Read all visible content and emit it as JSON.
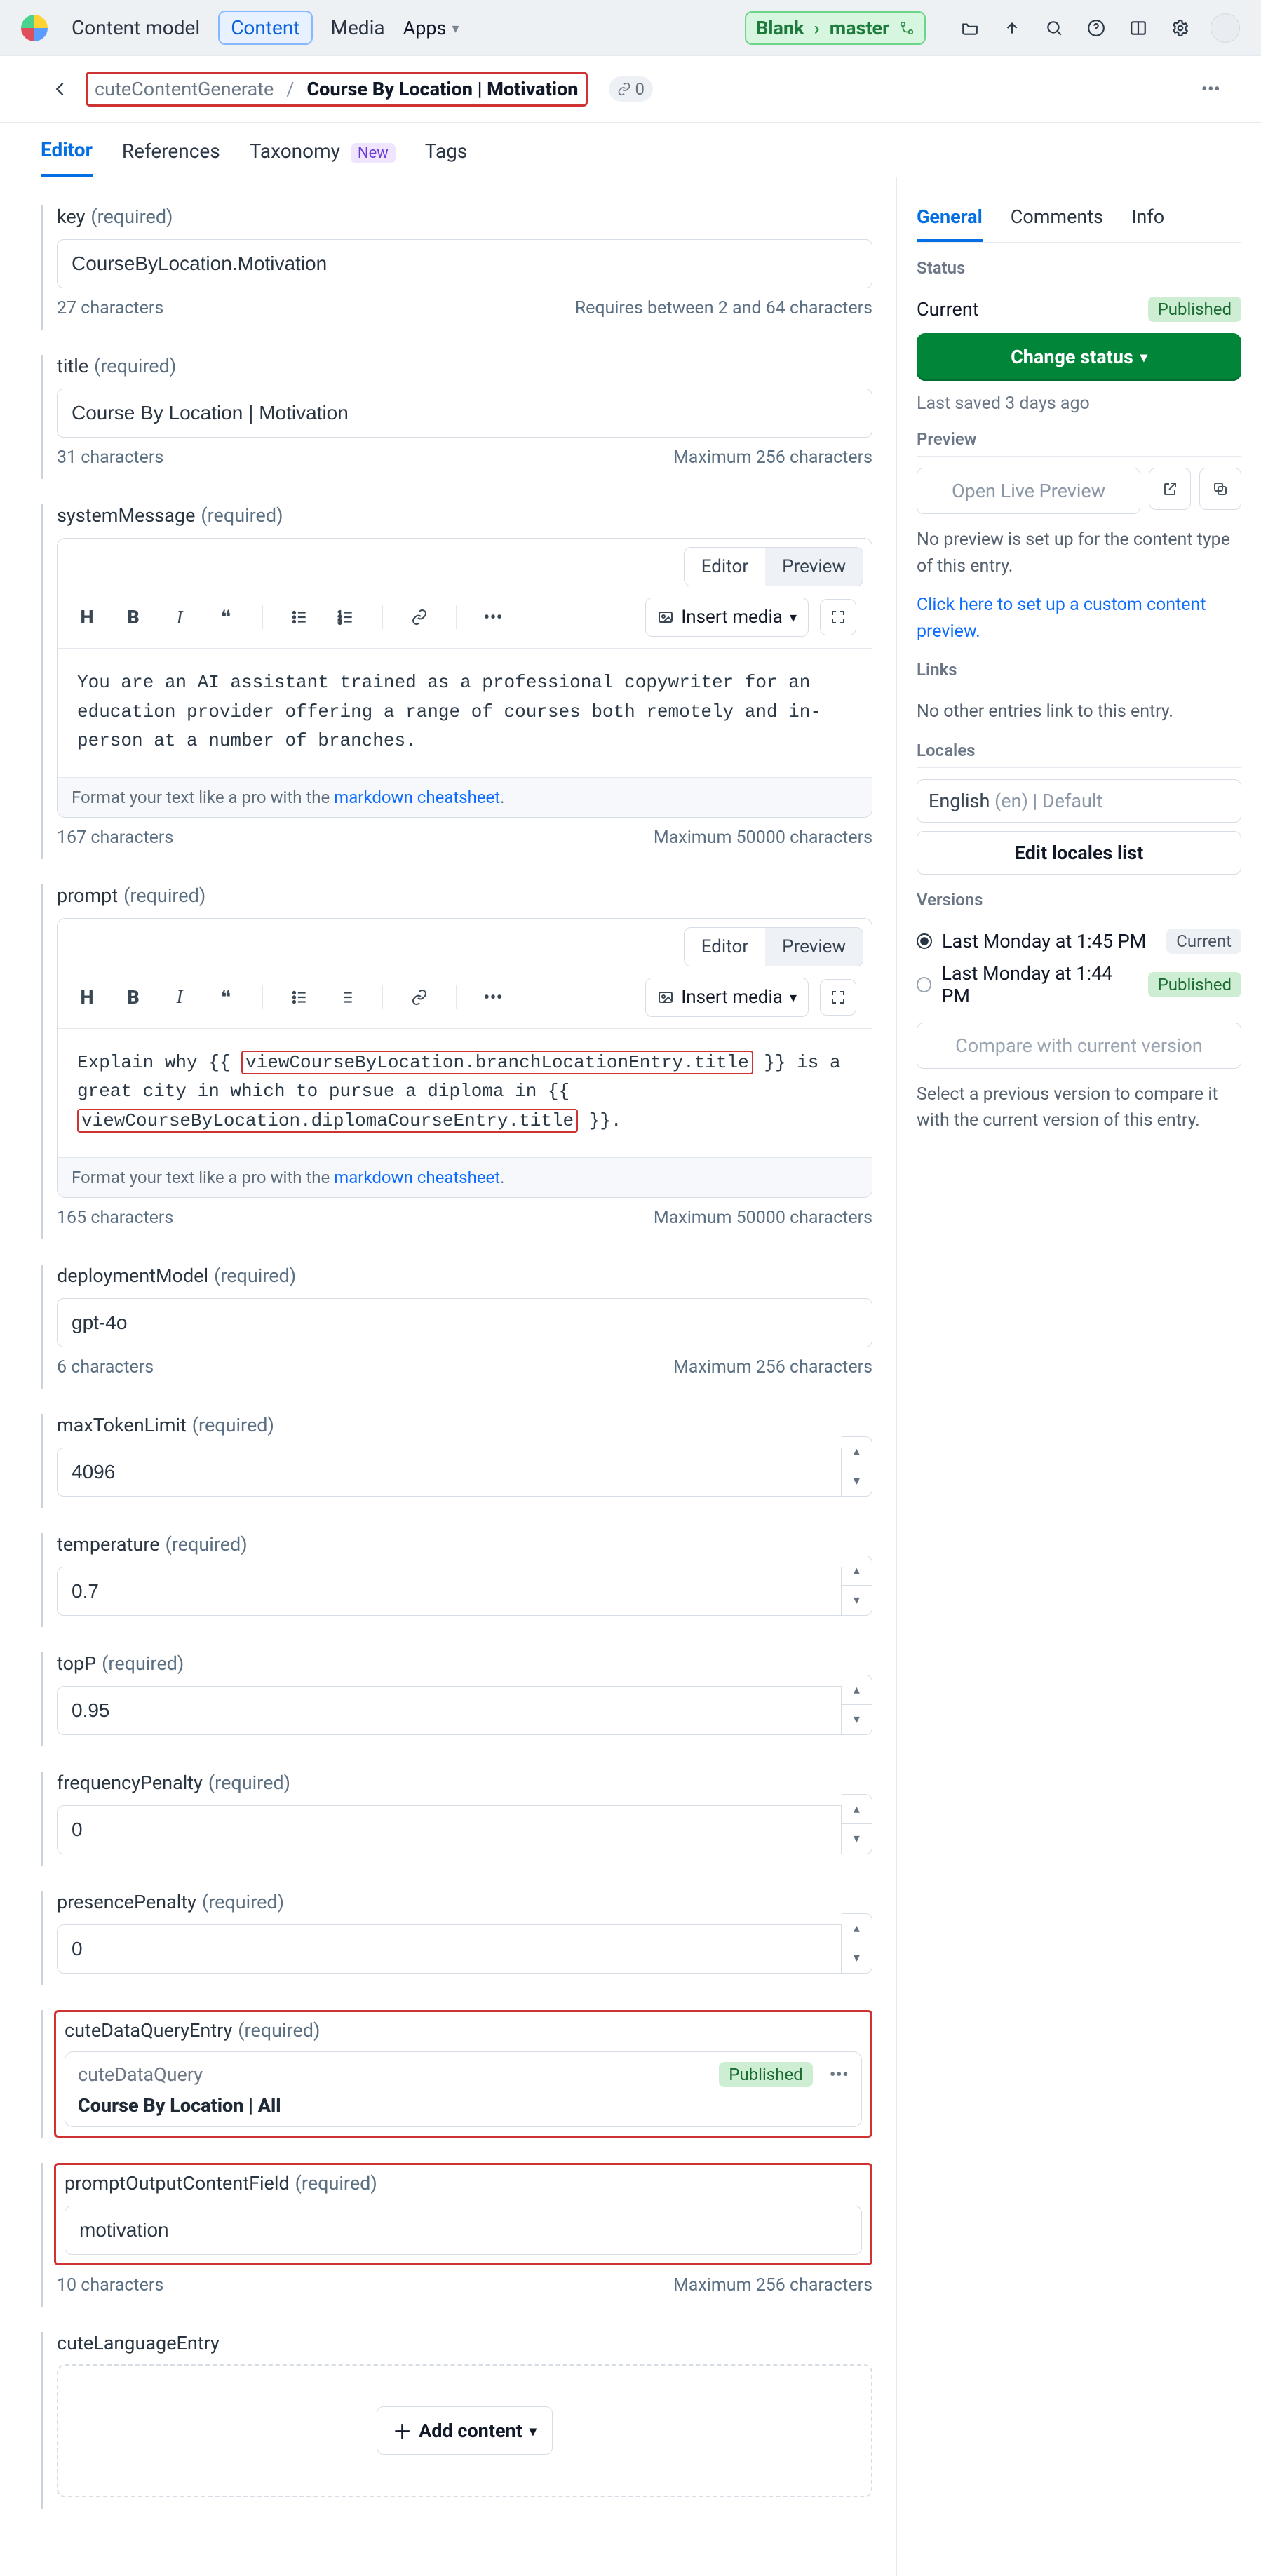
{
  "topnav": {
    "items": [
      "Content model",
      "Content",
      "Media",
      "Apps"
    ],
    "activeIndex": 1,
    "env": {
      "name": "Blank",
      "branch": "master"
    }
  },
  "header": {
    "crumbModel": "cuteContentGenerate",
    "crumbTitle": "Course By Location | Motivation",
    "linkCount": "0"
  },
  "tabs": {
    "items": [
      "Editor",
      "References",
      "Taxonomy",
      "Tags"
    ],
    "activeIndex": 0,
    "newBadge": "New"
  },
  "fields": {
    "key": {
      "label": "key",
      "req": "(required)",
      "value": "CourseByLocation.Motivation",
      "left": "27 characters",
      "right": "Requires between 2 and 64 characters"
    },
    "title": {
      "label": "title",
      "req": "(required)",
      "value": "Course By Location | Motivation",
      "left": "31 characters",
      "right": "Maximum 256 characters"
    },
    "systemMessage": {
      "label": "systemMessage",
      "req": "(required)",
      "editorTab": "Editor",
      "previewTab": "Preview",
      "insert": "Insert media",
      "body": "You are an AI assistant trained as a professional copywriter for an education provider offering a range of courses both remotely and in-person at a number of branches.",
      "footerPrefix": "Format your text like a pro with the ",
      "footerLink": "markdown cheatsheet",
      "footerSuffix": ".",
      "left": "167 characters",
      "right": "Maximum 50000 characters"
    },
    "prompt": {
      "label": "prompt",
      "req": "(required)",
      "editorTab": "Editor",
      "previewTab": "Preview",
      "insert": "Insert media",
      "pre1": "Explain why {{ ",
      "hl1": "viewCourseByLocation.branchLocationEntry.title",
      "mid1": " }} is a great city in which to pursue a diploma in {{ ",
      "hl2": "viewCourseByLocation.diplomaCourseEntry.title",
      "post1": " }}.",
      "footerPrefix": "Format your text like a pro with the ",
      "footerLink": "markdown cheatsheet",
      "footerSuffix": ".",
      "left": "165 characters",
      "right": "Maximum 50000 characters"
    },
    "deploymentModel": {
      "label": "deploymentModel",
      "req": "(required)",
      "value": "gpt-4o",
      "left": "6 characters",
      "right": "Maximum 256 characters"
    },
    "maxTokenLimit": {
      "label": "maxTokenLimit",
      "req": "(required)",
      "value": "4096"
    },
    "temperature": {
      "label": "temperature",
      "req": "(required)",
      "value": "0.7"
    },
    "topP": {
      "label": "topP",
      "req": "(required)",
      "value": "0.95"
    },
    "frequencyPenalty": {
      "label": "frequencyPenalty",
      "req": "(required)",
      "value": "0"
    },
    "presencePenalty": {
      "label": "presencePenalty",
      "req": "(required)",
      "value": "0"
    },
    "cuteDataQueryEntry": {
      "label": "cuteDataQueryEntry",
      "req": "(required)",
      "type": "cuteDataQuery",
      "title": "Course By Location | All",
      "badge": "Published"
    },
    "promptOutputContentField": {
      "label": "promptOutputContentField",
      "req": "(required)",
      "value": "motivation",
      "left": "10 characters",
      "right": "Maximum 256 characters"
    },
    "cuteLanguageEntry": {
      "label": "cuteLanguageEntry",
      "add": "Add content"
    }
  },
  "side": {
    "tabs": [
      "General",
      "Comments",
      "Info"
    ],
    "status": {
      "heading": "Status",
      "current": "Current",
      "badge": "Published",
      "change": "Change status",
      "saved": "Last saved 3 days ago"
    },
    "preview": {
      "heading": "Preview",
      "button": "Open Live Preview",
      "hint": "No preview is set up for the content type of this entry.",
      "link": "Click here to set up a custom content preview."
    },
    "links": {
      "heading": "Links",
      "text": "No other entries link to this entry."
    },
    "locales": {
      "heading": "Locales",
      "value": "English ",
      "sub": "(en) | Default",
      "edit": "Edit locales list"
    },
    "versions": {
      "heading": "Versions",
      "items": [
        {
          "label": "Last Monday at 1:45 PM",
          "badge": "Current",
          "sel": true,
          "gray": true
        },
        {
          "label": "Last Monday at 1:44 PM",
          "badge": "Published",
          "sel": false,
          "gray": false
        }
      ],
      "compare": "Compare with current version",
      "hint": "Select a previous version to compare it with the current version of this entry."
    }
  }
}
